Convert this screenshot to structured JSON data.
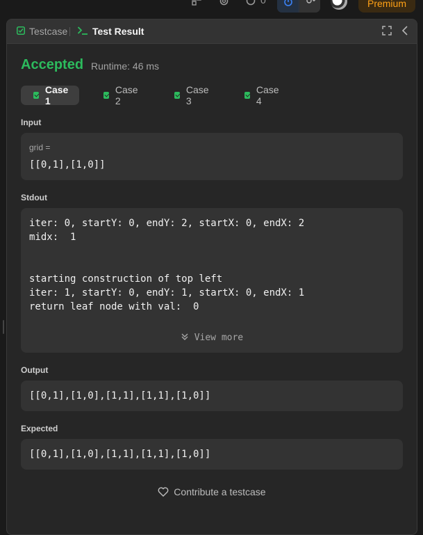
{
  "topbar": {
    "icons": [
      "layout-icon",
      "gear-icon",
      "fire-icon"
    ],
    "streak_count": "0",
    "premium_label": "Premium"
  },
  "panel": {
    "tabs": [
      {
        "label": "Testcase",
        "icon": "check-square-icon"
      },
      {
        "label": "Test Result",
        "icon": "terminal-icon"
      }
    ]
  },
  "result": {
    "status": "Accepted",
    "runtime": "Runtime: 46 ms",
    "status_color": "#2cbb5d"
  },
  "cases": [
    {
      "label": "Case 1",
      "active": true
    },
    {
      "label": "Case 2",
      "active": false
    },
    {
      "label": "Case 3",
      "active": false
    },
    {
      "label": "Case 4",
      "active": false
    }
  ],
  "input": {
    "label": "Input",
    "var_name": "grid =",
    "value": "[[0,1],[1,0]]"
  },
  "stdout": {
    "label": "Stdout",
    "lines": [
      "iter: 0, startY: 0, endY: 2, startX: 0, endX: 2",
      "midx:  1",
      "",
      "",
      "starting construction of top left",
      "iter: 1, startY: 0, endY: 1, startX: 0, endX: 1",
      "return leaf node with val:  0"
    ],
    "view_more": "View more"
  },
  "output": {
    "label": "Output",
    "value": "[[0,1],[1,0],[1,1],[1,1],[1,0]]"
  },
  "expected": {
    "label": "Expected",
    "value": "[[0,1],[1,0],[1,1],[1,1],[1,0]]"
  },
  "footer": {
    "contribute": "Contribute a testcase"
  }
}
